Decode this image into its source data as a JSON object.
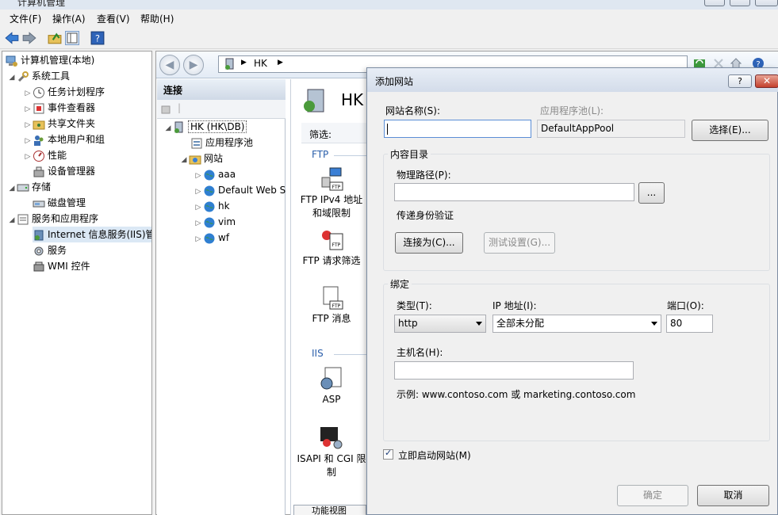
{
  "window": {
    "title": "计算机管理"
  },
  "menu": [
    "文件(F)",
    "操作(A)",
    "查看(V)",
    "帮助(H)"
  ],
  "tree": {
    "root": "计算机管理(本地)",
    "items": [
      {
        "label": "系统工具"
      },
      {
        "label": "任务计划程序"
      },
      {
        "label": "事件查看器"
      },
      {
        "label": "共享文件夹"
      },
      {
        "label": "本地用户和组"
      },
      {
        "label": "性能"
      },
      {
        "label": "设备管理器"
      },
      {
        "label": "存储"
      },
      {
        "label": "磁盘管理"
      },
      {
        "label": "服务和应用程序"
      },
      {
        "label": "Internet 信息服务(IIS)管"
      },
      {
        "label": "服务"
      },
      {
        "label": "WMI 控件"
      }
    ]
  },
  "iis": {
    "breadcrumb": [
      "HK"
    ],
    "connections_title": "连接",
    "server_node": "HK (HK\\DB)",
    "app_pool_node": "应用程序池",
    "sites_node": "网站",
    "sites": [
      "aaa",
      "Default Web S",
      "hk",
      "vim",
      "wf"
    ],
    "page_title": "HK",
    "filter_label": "筛选:",
    "group_ftp": "FTP",
    "group_iis": "IIS",
    "features": [
      {
        "label": "FTP IPv4 地址和域限制"
      },
      {
        "label": "FTP 请求筛选"
      },
      {
        "label": "FTP 消息"
      },
      {
        "label": "ASP"
      },
      {
        "label": "ISAPI 和 CGI 限制"
      }
    ],
    "bottom_tab": "功能视图"
  },
  "dialog": {
    "title": "添加网站",
    "help": "?",
    "site_name_label": "网站名称(S):",
    "site_name_value": "",
    "app_pool_label": "应用程序池(L):",
    "app_pool_value": "DefaultAppPool",
    "select_button": "选择(E)...",
    "content_group": "内容目录",
    "physical_path_label": "物理路径(P):",
    "physical_path_value": "",
    "browse_button": "...",
    "pass_auth_label": "传递身份验证",
    "connect_as_button": "连接为(C)...",
    "test_settings_button": "测试设置(G)...",
    "binding_group": "绑定",
    "type_label": "类型(T):",
    "type_value": "http",
    "ip_label": "IP 地址(I):",
    "ip_value": "全部未分配",
    "port_label": "端口(O):",
    "port_value": "80",
    "host_label": "主机名(H):",
    "host_value": "",
    "example_text": "示例: www.contoso.com 或 marketing.contoso.com",
    "start_site_label": "立即启动网站(M)",
    "start_site_checked": true,
    "ok_button": "确定",
    "cancel_button": "取消"
  }
}
